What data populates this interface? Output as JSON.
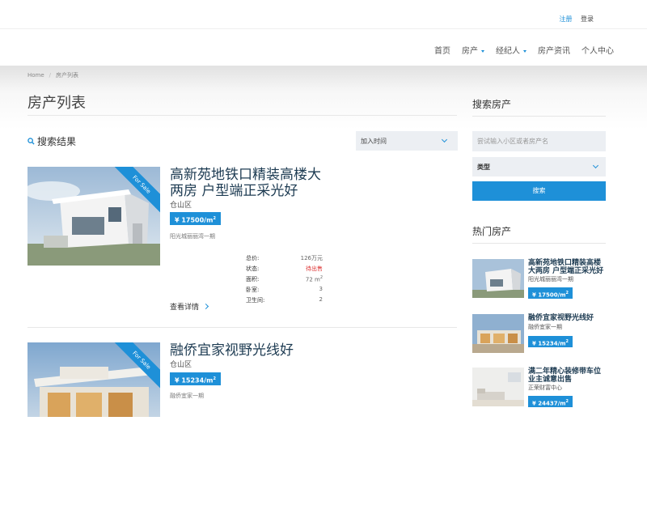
{
  "header": {
    "register": "注册",
    "login": "登录"
  },
  "nav": [
    {
      "label": "首页",
      "dropdown": false
    },
    {
      "label": "房产",
      "dropdown": true
    },
    {
      "label": "经纪人",
      "dropdown": true
    },
    {
      "label": "房产资讯",
      "dropdown": false
    },
    {
      "label": "个人中心",
      "dropdown": false
    }
  ],
  "breadcrumb": {
    "home": "Home",
    "sep": "/",
    "current": "房产列表"
  },
  "page_title": "房产列表",
  "results": {
    "heading": "搜索结果",
    "sort_selected": "加入时间",
    "ribbon_text": "For Sale",
    "detail_label": "查看详情",
    "spec_labels": {
      "total": "总价:",
      "status": "状态:",
      "area": "面积:",
      "bedrooms": "卧室:",
      "bathrooms": "卫生间:"
    },
    "listings": [
      {
        "title": "高新苑地铁口精装高楼大两房 户型端正采光好",
        "district": "仓山区",
        "price": "¥ 17500/m",
        "price_sup": "2",
        "community": "阳光城丽丽湾一期",
        "total": "126万元",
        "status": "待出售",
        "area": "72 m",
        "area_sup": "2",
        "bedrooms": "3",
        "bathrooms": "2"
      },
      {
        "title": "融侨宜家视野光线好",
        "district": "仓山区",
        "price": "¥ 15234/m",
        "price_sup": "2",
        "community": "融侨宜家一期",
        "total": "",
        "status": "",
        "area": "",
        "area_sup": "",
        "bedrooms": "",
        "bathrooms": ""
      }
    ]
  },
  "sidebar": {
    "search_title": "搜索房产",
    "search_placeholder": "尝试输入小区或者房产名",
    "type_selected": "类型",
    "search_button": "搜索",
    "hot_title": "热门房产",
    "hot": [
      {
        "title": "高新苑地铁口精装高楼大两房 户型端正采光好",
        "sub": "阳光城丽丽湾一期",
        "price": "¥ 17500/m",
        "sup": "2"
      },
      {
        "title": "融侨宜家视野光线好",
        "sub": "融侨宜家一期",
        "price": "¥ 15234/m",
        "sup": "2"
      },
      {
        "title": "满二年精心装修带车位业主诚意出售",
        "sub": "正荣财富中心",
        "price": "¥ 24437/m",
        "sup": "2"
      }
    ]
  },
  "colors": {
    "accent": "#1e90d8",
    "status_red": "#d33333",
    "title_navy": "#1d3b52"
  }
}
